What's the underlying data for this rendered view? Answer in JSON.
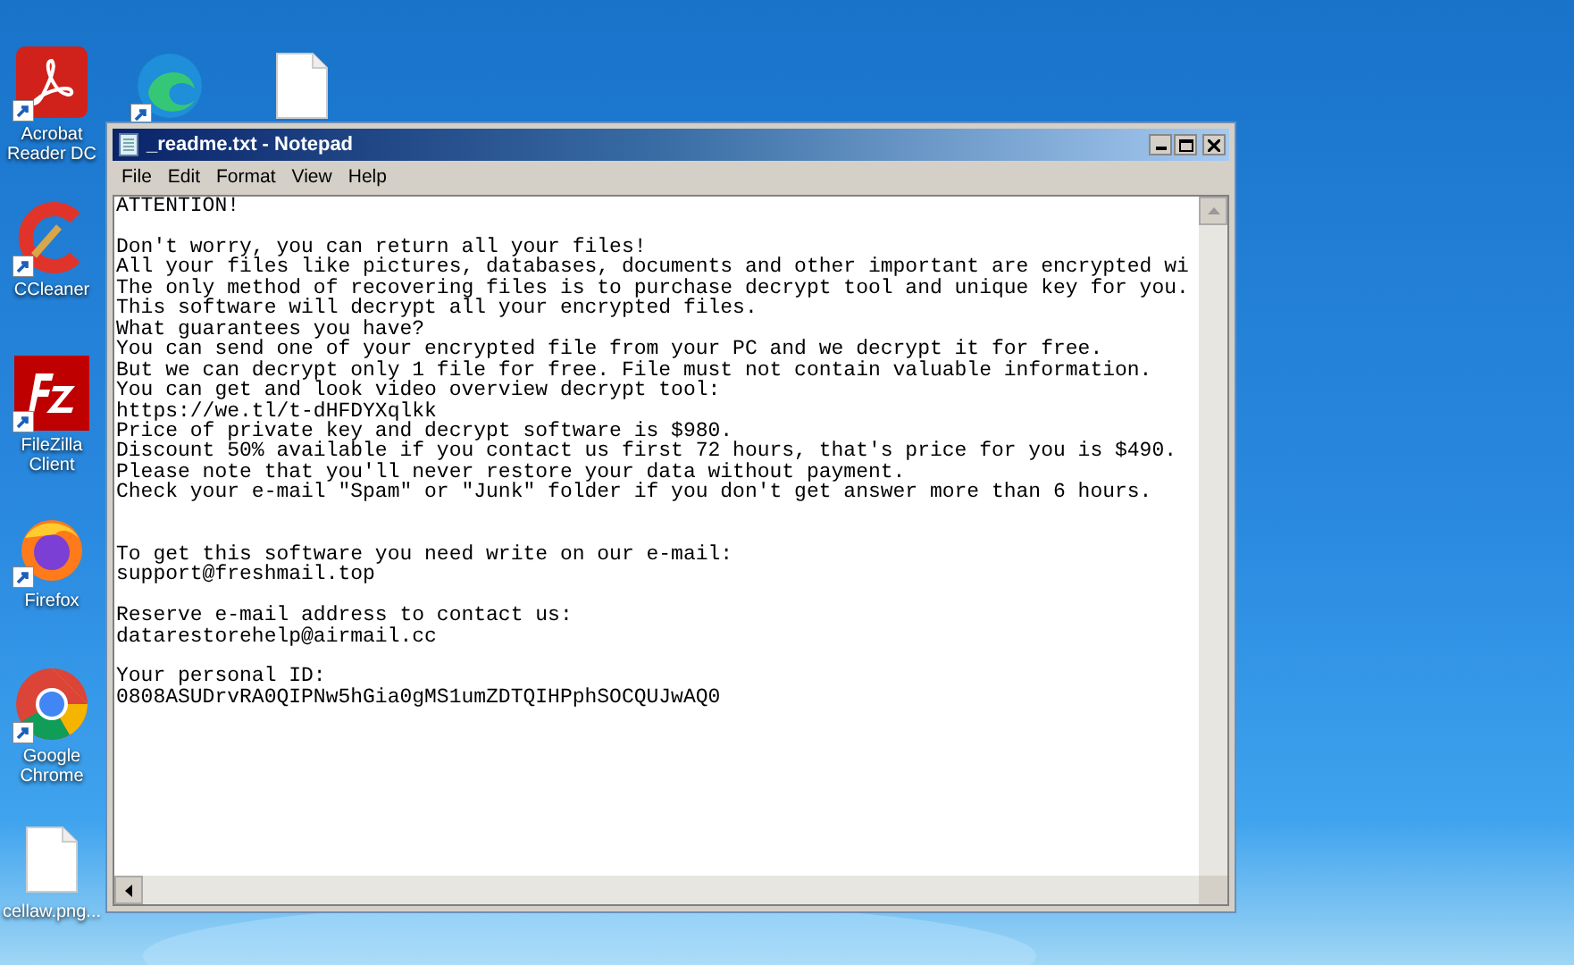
{
  "desktop_icons": [
    {
      "label": "Acrobat Reader DC",
      "kind": "acrobat",
      "shortcut": true
    },
    {
      "label": "CCleaner",
      "kind": "ccleaner",
      "shortcut": true
    },
    {
      "label": "FileZilla Client",
      "kind": "filezilla",
      "shortcut": true
    },
    {
      "label": "Firefox",
      "kind": "firefox",
      "shortcut": true
    },
    {
      "label": "Google Chrome",
      "kind": "chrome",
      "shortcut": true
    },
    {
      "label": "cellaw.png...",
      "kind": "file",
      "shortcut": false
    }
  ],
  "top_icons": [
    {
      "kind": "edge",
      "shortcut": true
    },
    {
      "kind": "file",
      "shortcut": false
    }
  ],
  "window": {
    "title": "_readme.txt - Notepad",
    "menu": [
      "File",
      "Edit",
      "Format",
      "View",
      "Help"
    ],
    "content": "ATTENTION!\n\nDon't worry, you can return all your files!\nAll your files like pictures, databases, documents and other important are encrypted wi\nThe only method of recovering files is to purchase decrypt tool and unique key for you.\nThis software will decrypt all your encrypted files.\nWhat guarantees you have?\nYou can send one of your encrypted file from your PC and we decrypt it for free.\nBut we can decrypt only 1 file for free. File must not contain valuable information.\nYou can get and look video overview decrypt tool:\nhttps://we.tl/t-dHFDYXqlkk\nPrice of private key and decrypt software is $980.\nDiscount 50% available if you contact us first 72 hours, that's price for you is $490.\nPlease note that you'll never restore your data without payment.\nCheck your e-mail \"Spam\" or \"Junk\" folder if you don't get answer more than 6 hours.\n\n\nTo get this software you need write on our e-mail:\nsupport@freshmail.top\n\nReserve e-mail address to contact us:\ndatarestorehelp@airmail.cc\n\nYour personal ID:\n0808ASUDrvRA0QIPNw5hGia0gMS1umZDTQIHPphSOCQUJwAQ0"
  }
}
